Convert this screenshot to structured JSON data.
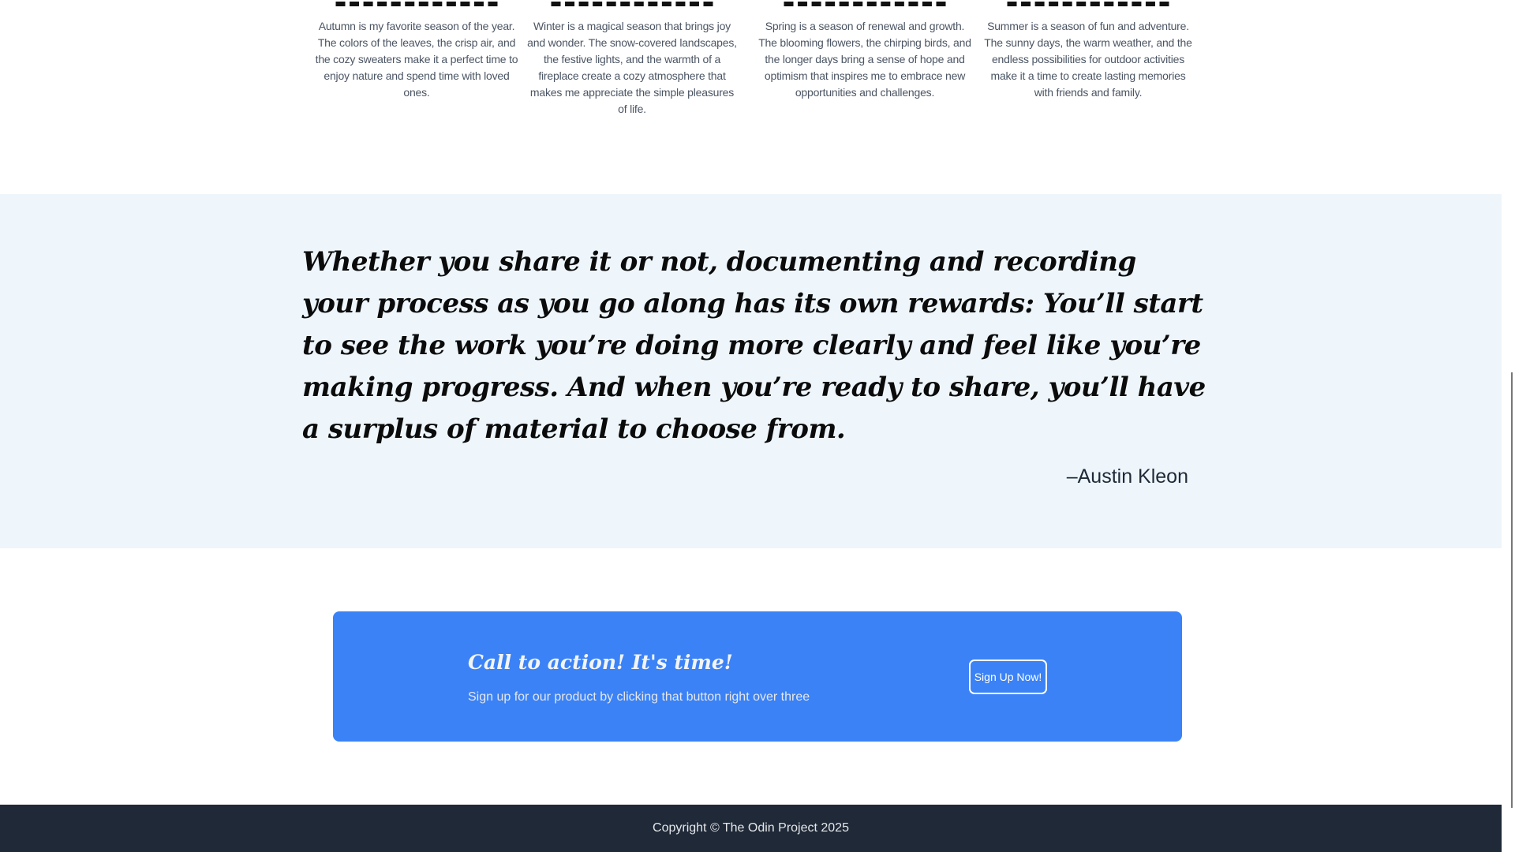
{
  "seasons": [
    {
      "text": "Autumn is my favorite season of the year. The colors of the leaves, the crisp air, and the cozy sweaters make it a perfect time to enjoy nature and spend time with loved ones."
    },
    {
      "text": "Winter is a magical season that brings joy and wonder. The snow-covered landscapes, the festive lights, and the warmth of a fireplace create a cozy atmosphere that makes me appreciate the simple pleasures of life."
    },
    {
      "text": "Spring is a season of renewal and growth. The blooming flowers, the chirping birds, and the longer days bring a sense of hope and optimism that inspires me to embrace new opportunities and challenges."
    },
    {
      "text": "Summer is a season of fun and adventure. The sunny days, the warm weather, and the endless possibilities for outdoor activities make it a time to create lasting memories with friends and family."
    }
  ],
  "quote": {
    "text": "Whether you share it or not, documenting and recording your process as you go along has its own rewards: You’ll start to see the work you’re doing more clearly and feel like you’re making progress. And when you’re ready to share, you’ll have a surplus of material to choose from.",
    "author": "–Austin Kleon"
  },
  "cta": {
    "title": "Call to action! It's time!",
    "subtitle": "Sign up for our product by clicking that button right over three",
    "button_label": "Sign Up Now!"
  },
  "footer": {
    "copyright": "Copyright © The Odin Project 2025"
  },
  "colors": {
    "quote_bg": "#eef6fc",
    "cta_bg": "#3b82f6",
    "footer_bg": "#1f2937"
  }
}
